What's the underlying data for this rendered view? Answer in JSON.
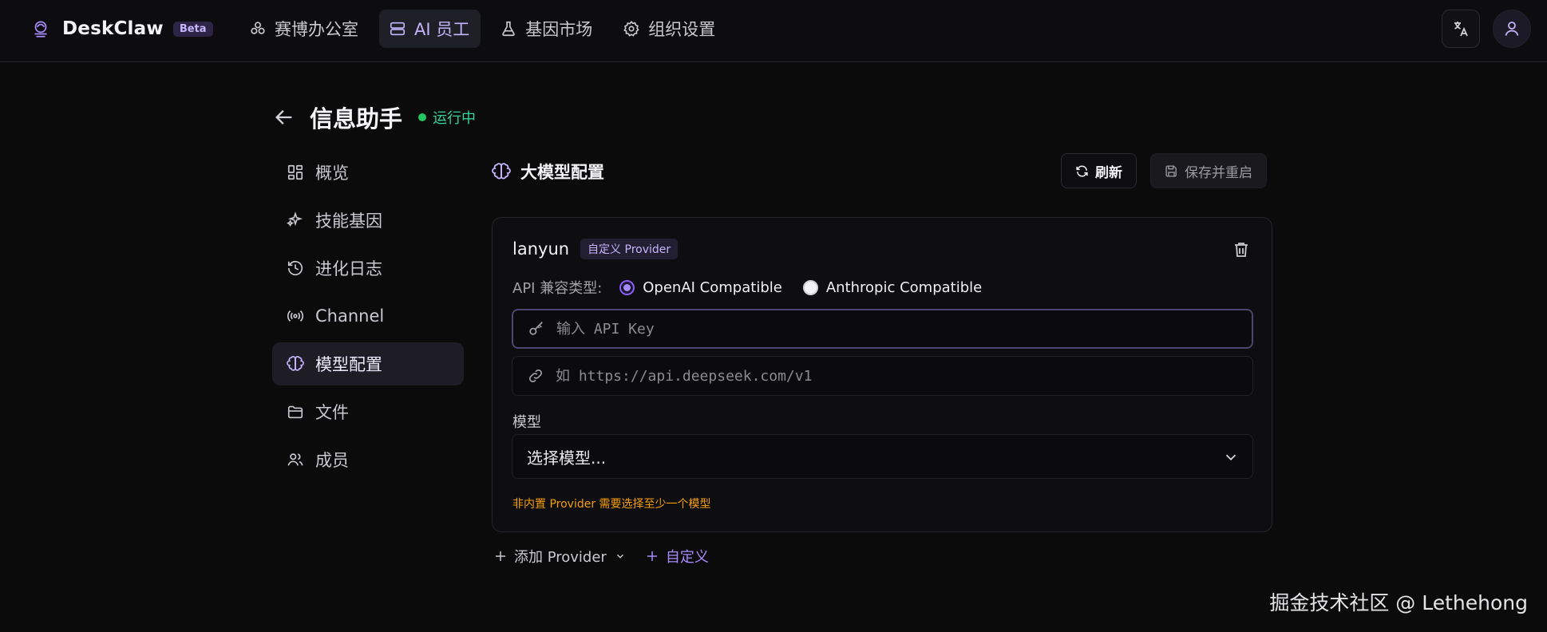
{
  "app": {
    "name": "DeskClaw",
    "badge": "Beta"
  },
  "nav": {
    "items": [
      {
        "label": "赛博办公室",
        "icon": "network-icon"
      },
      {
        "label": "AI 员工",
        "icon": "server-icon",
        "active": true
      },
      {
        "label": "基因市场",
        "icon": "flask-icon"
      },
      {
        "label": "组织设置",
        "icon": "gear-icon"
      }
    ]
  },
  "agent": {
    "name": "信息助手",
    "status": "运行中"
  },
  "side": {
    "items": [
      {
        "label": "概览",
        "icon": "dashboard-icon"
      },
      {
        "label": "技能基因",
        "icon": "sparkle-icon"
      },
      {
        "label": "进化日志",
        "icon": "history-icon"
      },
      {
        "label": "Channel",
        "icon": "broadcast-icon"
      },
      {
        "label": "模型配置",
        "icon": "brain-icon",
        "active": true
      },
      {
        "label": "文件",
        "icon": "folder-icon"
      },
      {
        "label": "成员",
        "icon": "users-icon"
      }
    ]
  },
  "section": {
    "title": "大模型配置",
    "refresh_label": "刷新",
    "save_label": "保存并重启"
  },
  "provider": {
    "name": "lanyun",
    "tag": "自定义 Provider",
    "api_type_label": "API 兼容类型:",
    "api_options": [
      "OpenAI Compatible",
      "Anthropic Compatible"
    ],
    "api_selected": "OpenAI Compatible",
    "api_key_value": "",
    "api_key_placeholder": "输入 API Key",
    "base_url_value": "",
    "base_url_placeholder": "如 https://api.deepseek.com/v1",
    "model_label": "模型",
    "model_selected": "选择模型...",
    "warning": "非内置 Provider 需要选择至少一个模型"
  },
  "footer": {
    "add_provider_label": "添加 Provider",
    "custom_label": "自定义"
  },
  "watermark": "掘金技术社区 @ Lethehong",
  "colors": {
    "accent": "#a78bfa",
    "background": "#0b0b0c",
    "status_running": "#22c55e",
    "warning": "#f59e0b"
  }
}
